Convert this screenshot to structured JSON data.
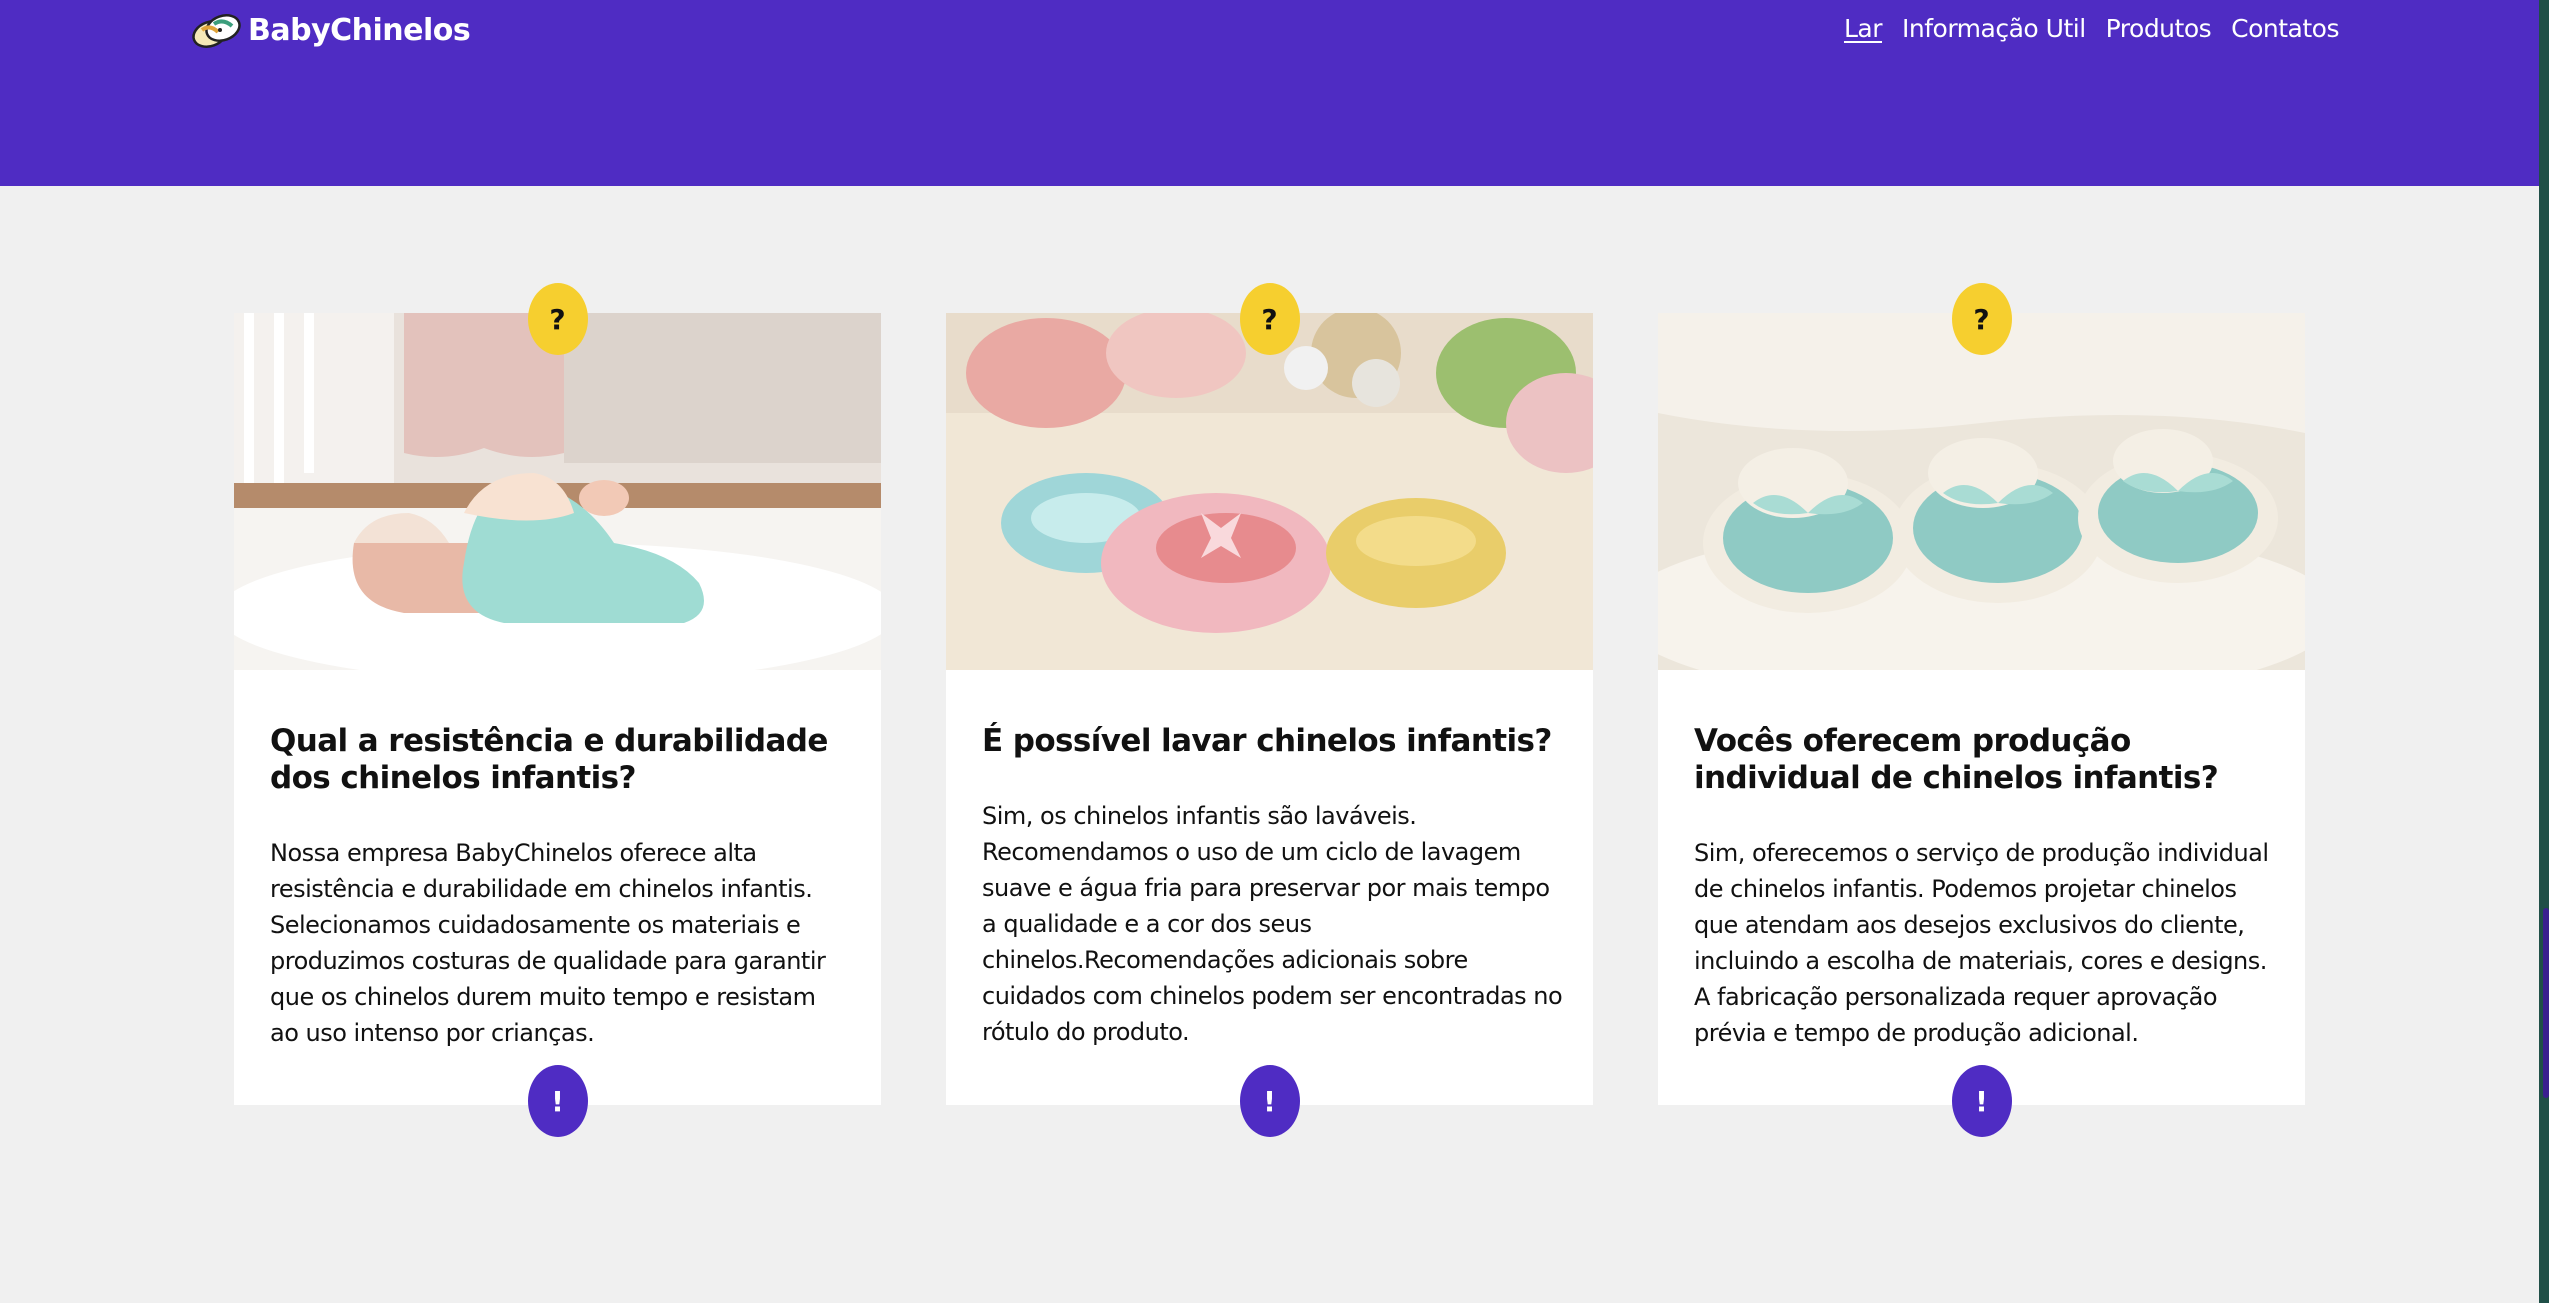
{
  "brand": {
    "name": "BabyChinelos",
    "icon": "slippers-logo-icon"
  },
  "nav": {
    "items": [
      {
        "label": "Lar",
        "active": true
      },
      {
        "label": "Informação Util",
        "active": false
      },
      {
        "label": "Produtos",
        "active": false
      },
      {
        "label": "Contatos",
        "active": false
      }
    ]
  },
  "colors": {
    "primary": "#4f2cc3",
    "accent": "#f6cf2f",
    "background": "#f0f0f0",
    "card": "#ffffff"
  },
  "faq": {
    "badge_question": "?",
    "badge_exclaim": "!",
    "cards": [
      {
        "image_icon": "teal-pink-slippers-on-rug-image",
        "title": "Qual a resistência e durabilidade dos chinelos infantis?",
        "body": "Nossa empresa BabyChinelos oferece alta resistência e durabilidade em chinelos infantis. Selecionamos cuidadosamente os materiais e produzimos costuras de qualidade para garantir que os chinelos durem muito tempo e resistam ao uso intenso por crianças."
      },
      {
        "image_icon": "crochet-baby-shoes-image",
        "title": "É possível lavar chinelos infantis?",
        "body": "Sim, os chinelos infantis são laváveis. Recomendamos o uso de um ciclo de lavagem suave e água fria para preservar por mais tempo a qualidade e a cor dos seus chinelos.Recomendações adicionais sobre cuidados com chinelos podem ser encontradas no rótulo do produto."
      },
      {
        "image_icon": "knitted-teal-booties-image",
        "title": "Vocês oferecem produção individual de chinelos infantis?",
        "body": "Sim, oferecemos o serviço de produção individual de chinelos infantis. Podemos projetar chinelos que atendam aos desejos exclusivos do cliente, incluindo a escolha de materiais, cores e designs. A fabricação personalizada requer aprovação prévia e tempo de produção adicional."
      }
    ]
  }
}
